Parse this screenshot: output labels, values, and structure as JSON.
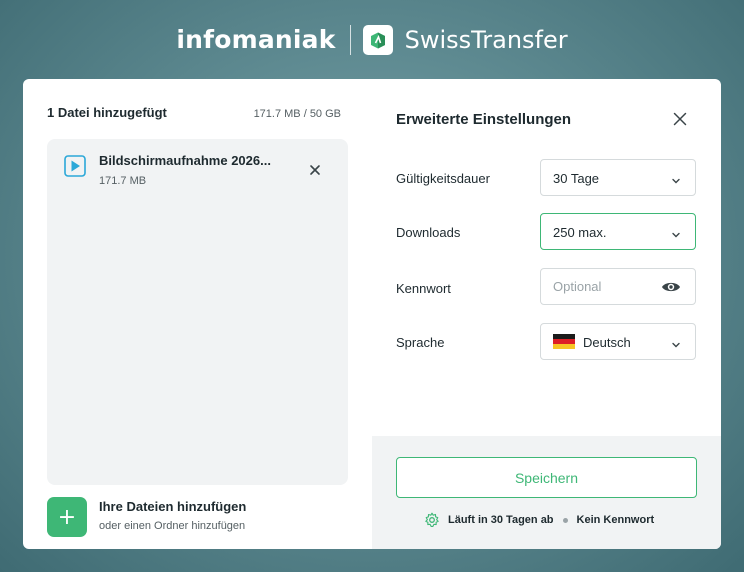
{
  "header": {
    "brand": "infomaniak",
    "product": "SwissTransfer"
  },
  "files": {
    "count_label": "1 Datei hinzugefügt",
    "usage": "171.7 MB / 50 GB",
    "items": [
      {
        "name": "Bildschirmaufnahme 2026...",
        "size": "171.7 MB",
        "icon": "video-file-icon"
      }
    ]
  },
  "add": {
    "button_symbol": "+",
    "title": "Ihre Dateien hinzufügen",
    "subtitle": "oder einen Ordner hinzufügen"
  },
  "settings": {
    "title": "Erweiterte Einstellungen",
    "validity": {
      "label": "Gültigkeitsdauer",
      "value": "30 Tage"
    },
    "downloads": {
      "label": "Downloads",
      "value": "250 max."
    },
    "password": {
      "label": "Kennwort",
      "placeholder": "Optional",
      "value": ""
    },
    "language": {
      "label": "Sprache",
      "value": "Deutsch",
      "flag": "de-flag-icon"
    }
  },
  "footer": {
    "save_label": "Speichern",
    "expiry": "Läuft in 30 Tagen ab",
    "password_status": "Kein Kennwort"
  },
  "colors": {
    "accent": "#3eb776",
    "panel": "#f1f3f4",
    "background": "#5f8b92"
  }
}
